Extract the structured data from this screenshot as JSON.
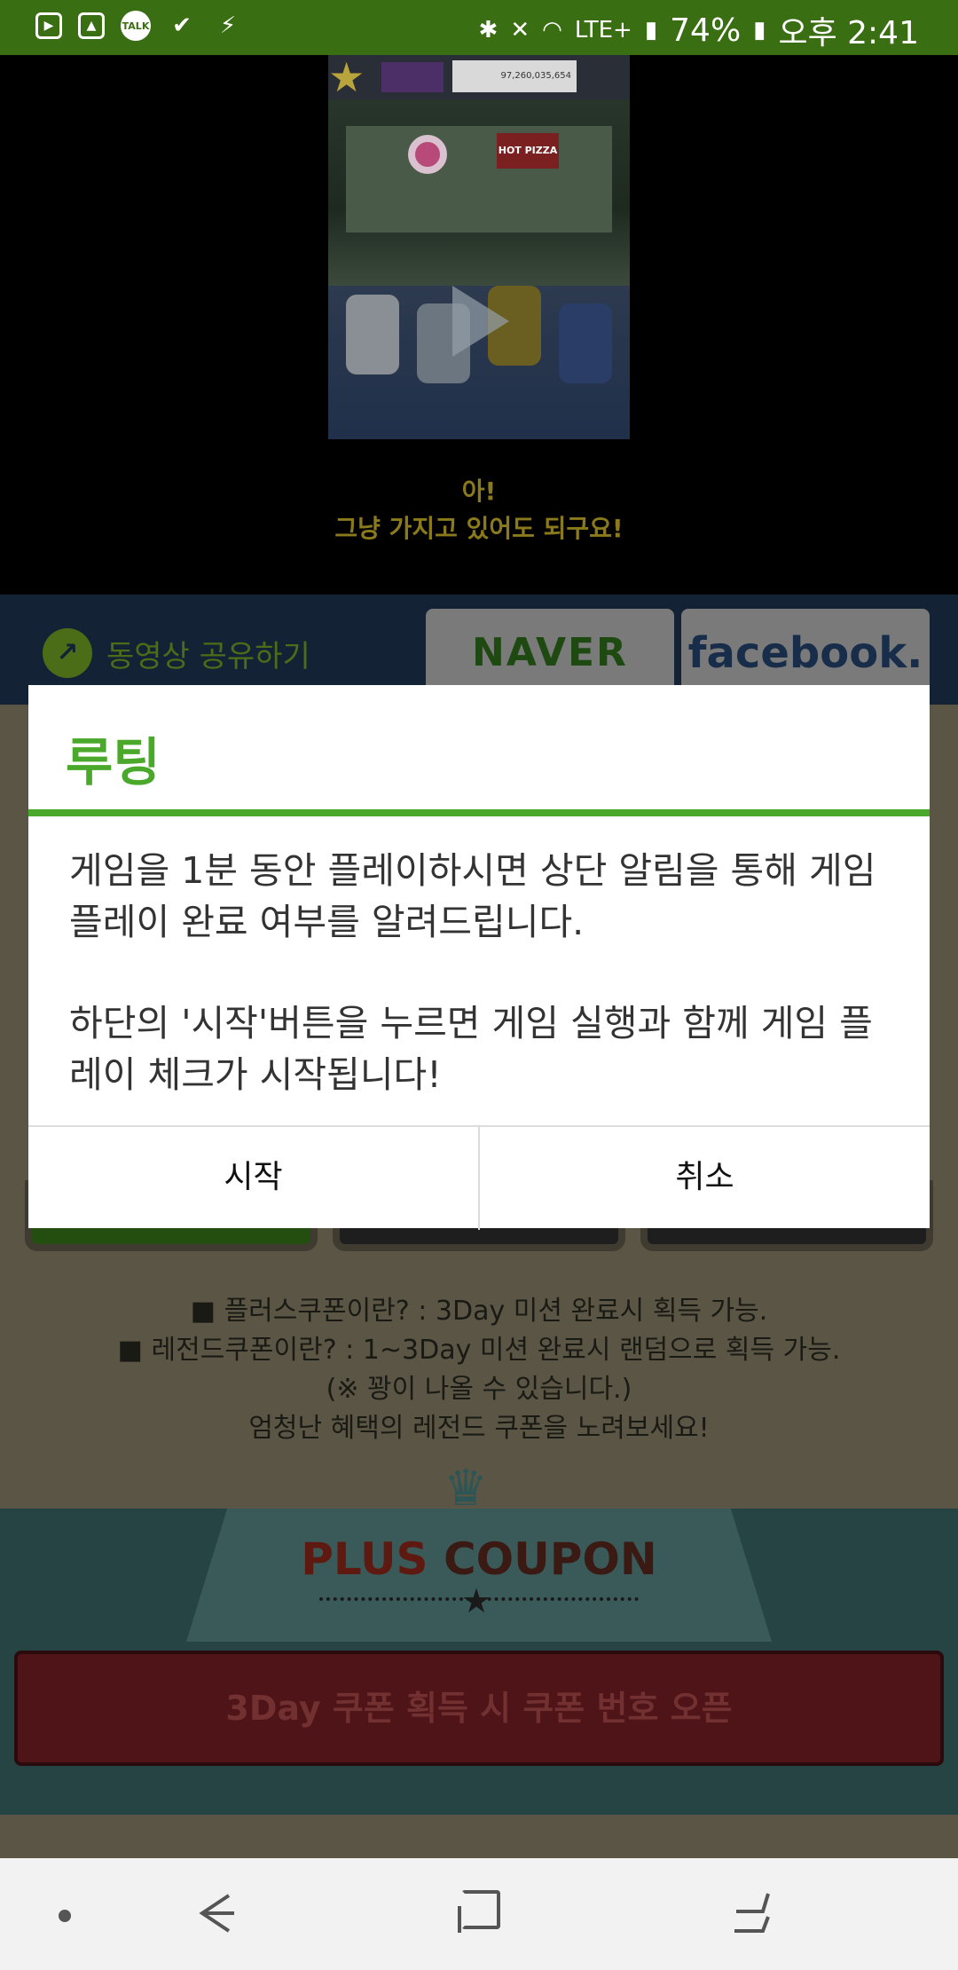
{
  "status_bar": {
    "battery": "74%",
    "time": "오후 2:41",
    "network": "LTE+",
    "left_icons": [
      "play-icon",
      "gallery-icon",
      "kakaotalk-icon",
      "check-icon",
      "charging-icon"
    ],
    "talk_label": "TALK",
    "right_icons": [
      "bluetooth-icon",
      "mute-icon",
      "wifi-icon",
      "signal-icon",
      "battery-icon"
    ]
  },
  "video": {
    "caption_line1": "아!",
    "caption_line2": "그냥 가지고 있어도 되구요!",
    "money_text": "97,260,035,654",
    "pizza_text": "HOT PIZZA"
  },
  "share": {
    "label": "동영상 공유하기",
    "naver": "NAVER",
    "facebook": "facebook."
  },
  "info": {
    "line1": "■ 플러스쿠폰이란? : 3Day 미션 완료시 획득 가능.",
    "line2": "■ 레전드쿠폰이란? : 1~3Day 미션 완료시 랜덤으로 획득 가능.",
    "line3": "(※ 꽝이 나올 수 있습니다.)",
    "line4": "엄청난 혜택의 레전드 쿠폰을 노려보세요!"
  },
  "plus_coupon": {
    "title_a": "PLUS",
    "title_b": " COUPON",
    "open_button": "3Day 쿠폰 획득 시 쿠폰 번호 오픈"
  },
  "dialog": {
    "title": "루팅",
    "message_p1": "게임을 1분 동안 플레이하시면 상단 알림을 통해 게임 플레이 완료 여부를 알려드립니다.",
    "message_p2": "하단의 '시작'버튼을 누르면 게임 실행과 함께 게임 플레이 체크가 시작됩니다!",
    "start_button": "시작",
    "cancel_button": "취소"
  },
  "colors": {
    "status_bg": "#3a6e12",
    "accent_green": "#4aa82a",
    "nav_bg": "#f2f2f2"
  }
}
